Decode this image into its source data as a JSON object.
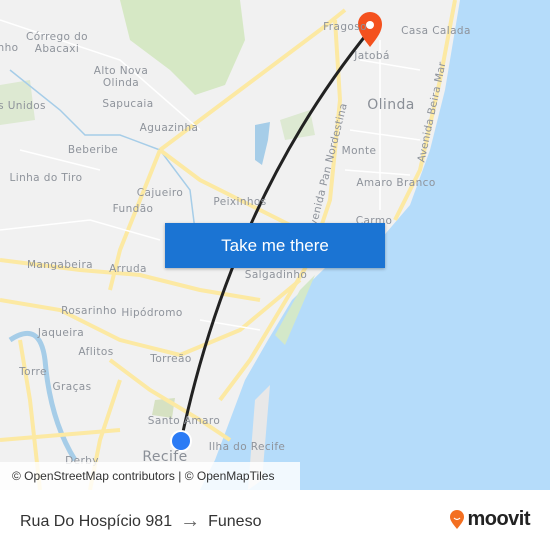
{
  "map": {
    "labels": [
      "nho",
      "Córrego do\nAbacaxi",
      "Alto Nova\nOlinda",
      "s Unidos",
      "Sapucaia",
      "Aguazinha",
      "Beberibe",
      "Linha do Tiro",
      "Cajueiro",
      "Fundão",
      "Peixinhos",
      "Fragoso",
      "Casa Calada",
      "Jatobá",
      "Olinda",
      "Monte",
      "Amaro Branco",
      "Carmo",
      "Mangabeira",
      "Arruda",
      "Salgadinho",
      "Rosarinho",
      "Hipódromo",
      "Jaqueira",
      "Aflitos",
      "Torreão",
      "Torre",
      "Graças",
      "Santo Amaro",
      "Ilha do Recife",
      "Recife",
      "Derby"
    ],
    "street_labels": [
      "Avenida Pan Nordestina",
      "Avenida Beira Mar"
    ],
    "colors": {
      "land": "#f1f1f1",
      "sea": "#b5dcfa",
      "road": "#fce9a3",
      "park": "#d6e8c5",
      "route": "#222222",
      "destination_pin": "#f4511e",
      "origin_dot": "#2b7bf5"
    }
  },
  "cta": {
    "label": "Take me there"
  },
  "attribution": "© OpenStreetMap contributors | © OpenMapTiles",
  "footer": {
    "origin": "Rua Do Hospício 981",
    "arrow": "→",
    "destination": "Funeso",
    "brand": "moovit",
    "brand_color": "#f36f21"
  }
}
